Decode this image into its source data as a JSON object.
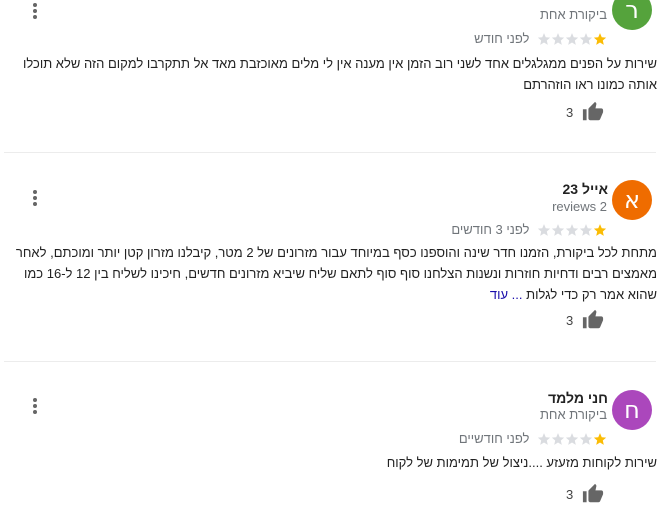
{
  "colors": {
    "star_filled": "#fbbc04",
    "star_empty": "#dadce0",
    "link": "#1a0dab"
  },
  "reviews": [
    {
      "avatar_letter": "ר",
      "avatar_color": "#55a33c",
      "author": "",
      "meta": "ביקורת אחת",
      "rating": 1,
      "date": "לפני חודש",
      "text": "שירות על הפנים ממגלגלים אחד לשני  רוב הזמן אין מענה אין לי מלים מאוכזבת  מאד אל תתקרבו למקום הזה שלא תוכלו אותה כמונו ראו הוזהרתם",
      "more": "",
      "likes": "3"
    },
    {
      "avatar_letter": "א",
      "avatar_color": "#ef6c00",
      "author": "אייל 23",
      "meta": "2 reviews",
      "rating": 1,
      "date": "לפני 3 חודשים",
      "text": "מתחת לכל ביקורת, הזמנו חדר שינה והוספנו כסף במיוחד עבור מזרונים של 2 מטר, קיבלנו מזרון קטן יותר ומוכתם, לאחר מאמצים רבים ודחיות חוזרות ונשנות הצלחנו סוף סוף לתאם שליח שיביא מזרונים חדשים, חיכינו לשליח בין 12 ל-16 כמו שהוא אמר רק כדי לגלות",
      "more": "... עוד",
      "likes": "3"
    },
    {
      "avatar_letter": "ח",
      "avatar_color": "#ab47bc",
      "author": "חני מלמד",
      "meta": "ביקורת אחת",
      "rating": 1,
      "date": "לפני חודשיים",
      "text": "שירות לקוחות מזעזע ....ניצול של תמימות של לקוח",
      "more": "",
      "likes": "3"
    }
  ]
}
